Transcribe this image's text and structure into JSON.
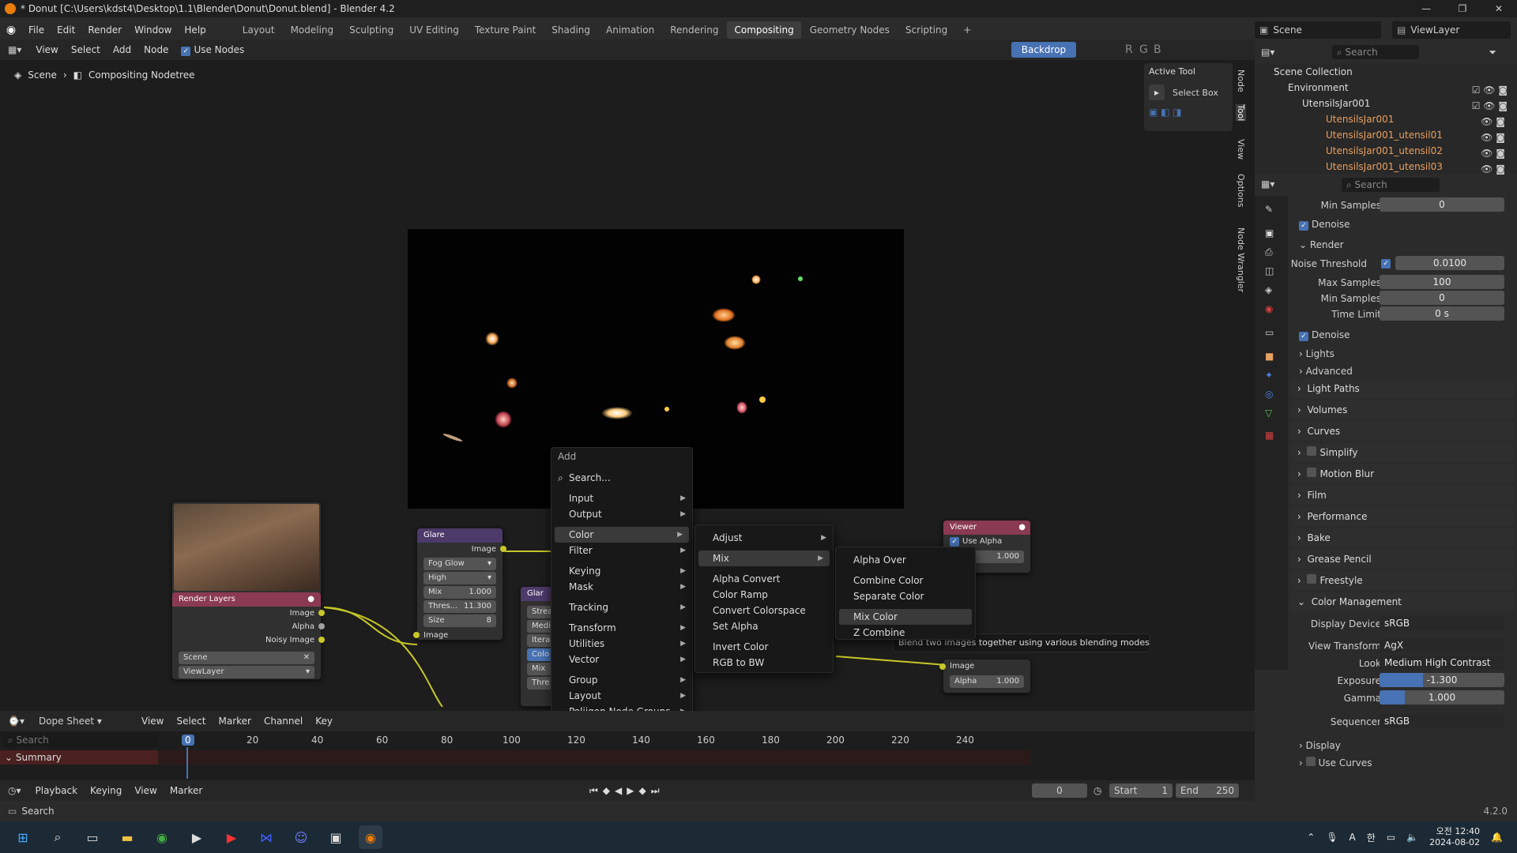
{
  "window": {
    "title": "* Donut [C:\\Users\\kdst4\\Desktop\\1.1\\Blender\\Donut\\Donut.blend] - Blender 4.2"
  },
  "menus": [
    "File",
    "Edit",
    "Render",
    "Window",
    "Help"
  ],
  "workspaces": [
    "Layout",
    "Modeling",
    "Sculpting",
    "UV Editing",
    "Texture Paint",
    "Shading",
    "Animation",
    "Rendering",
    "Compositing",
    "Geometry Nodes",
    "Scripting"
  ],
  "active_workspace": "Compositing",
  "scene": {
    "name": "Scene",
    "view_layer": "ViewLayer"
  },
  "node_editor": {
    "menus": [
      "View",
      "Select",
      "Add",
      "Node"
    ],
    "use_nodes": "Use Nodes",
    "breadcrumb": [
      "Scene",
      "Compositing Nodetree"
    ],
    "backdrop": "Backdrop",
    "channels": [
      "R",
      "G",
      "B"
    ]
  },
  "side_tabs": [
    "Node",
    "Tool",
    "View",
    "Options",
    "Node Wrangler"
  ],
  "active_tool": {
    "title": "Active Tool",
    "tool": "Select Box"
  },
  "nodes": {
    "glare": {
      "title": "Glare",
      "output": "Image",
      "type": "Fog Glow",
      "quality": "High",
      "mix_label": "Mix",
      "mix": "1.000",
      "threshold_label": "Thres...",
      "threshold": "11.300",
      "size_label": "Size",
      "size": "8",
      "input": "Image"
    },
    "glare2": {
      "title": "Glar",
      "rows": [
        "Streak",
        "Medi",
        "Itera",
        "Colo",
        "Mix",
        "Thre"
      ]
    },
    "render_layers": {
      "title": "Render Layers",
      "outputs": [
        "Image",
        "Alpha",
        "Noisy Image"
      ],
      "scene": "Scene",
      "view_layer": "ViewLayer"
    },
    "viewer": {
      "title": "Viewer",
      "use_alpha": "Use Alpha",
      "value": "1.000"
    },
    "composite": {
      "input": "Image",
      "alpha_label": "Alpha",
      "alpha": "1.000"
    }
  },
  "add_menu": {
    "title": "Add",
    "search": "Search...",
    "items": [
      "Input",
      "Output",
      "Color",
      "Filter",
      "Keying",
      "Mask",
      "Tracking",
      "Transform",
      "Utilities",
      "Vector",
      "Group",
      "Layout",
      "Poliigon Node Groups"
    ]
  },
  "color_menu": {
    "items": [
      "Adjust",
      "Mix",
      "Alpha Convert",
      "Color Ramp",
      "Convert Colorspace",
      "Set Alpha",
      "Invert Color",
      "RGB to BW"
    ]
  },
  "mix_menu": {
    "items": [
      "Alpha Over",
      "Combine Color",
      "Separate Color",
      "Mix Color",
      "Z Combine"
    ]
  },
  "tooltip": "Blend two images together using various blending modes.",
  "outliner": {
    "search": "Search",
    "items": [
      "Scene Collection",
      "Environment",
      "UtensilsJar001",
      "UtensilsJar001",
      "UtensilsJar001_utensil01",
      "UtensilsJar001_utensil02",
      "UtensilsJar001_utensil03"
    ]
  },
  "properties": {
    "search": "Search",
    "min_samples_top": {
      "label": "Min Samples",
      "value": "0"
    },
    "denoise1": "Denoise",
    "render": "Render",
    "noise_threshold": {
      "label": "Noise Threshold",
      "value": "0.0100"
    },
    "max_samples": {
      "label": "Max Samples",
      "value": "100"
    },
    "min_samples": {
      "label": "Min Samples",
      "value": "0"
    },
    "time_limit": {
      "label": "Time Limit",
      "value": "0 s"
    },
    "denoise2": "Denoise",
    "lights": "Lights",
    "advanced": "Advanced",
    "panels": [
      "Light Paths",
      "Volumes",
      "Curves",
      "Simplify",
      "Motion Blur",
      "Film",
      "Performance",
      "Bake",
      "Grease Pencil",
      "Freestyle",
      "Color Management"
    ],
    "display_device": {
      "label": "Display Device",
      "value": "sRGB"
    },
    "view_transform": {
      "label": "View Transform",
      "value": "AgX"
    },
    "look": {
      "label": "Look",
      "value": "Medium High Contrast"
    },
    "exposure": {
      "label": "Exposure",
      "value": "-1.300",
      "fill": 0.35
    },
    "gamma": {
      "label": "Gamma",
      "value": "1.000",
      "fill": 0.2
    },
    "sequencer": {
      "label": "Sequencer",
      "value": "sRGB"
    },
    "display": "Display",
    "use_curves": "Use Curves"
  },
  "dopesheet": {
    "mode": "Dope Sheet",
    "menus": [
      "View",
      "Select",
      "Marker",
      "Channel",
      "Key"
    ],
    "search": "Search",
    "summary": "Summary",
    "frame_marks": [
      "0",
      "20",
      "40",
      "60",
      "80",
      "100",
      "120",
      "140",
      "160",
      "180",
      "200",
      "220",
      "240"
    ],
    "current_frame_marker": "0"
  },
  "timeline": {
    "menus": [
      "Playback",
      "Keying",
      "View",
      "Marker"
    ],
    "current_frame": "0",
    "start_label": "Start",
    "start": "1",
    "end_label": "End",
    "end": "250"
  },
  "statusbar": {
    "left": "Search",
    "version": "4.2.0"
  },
  "taskbar": {
    "lang": "A",
    "ime": "한",
    "time": "12:40",
    "ampm": "오전",
    "date": "2024-08-02"
  }
}
